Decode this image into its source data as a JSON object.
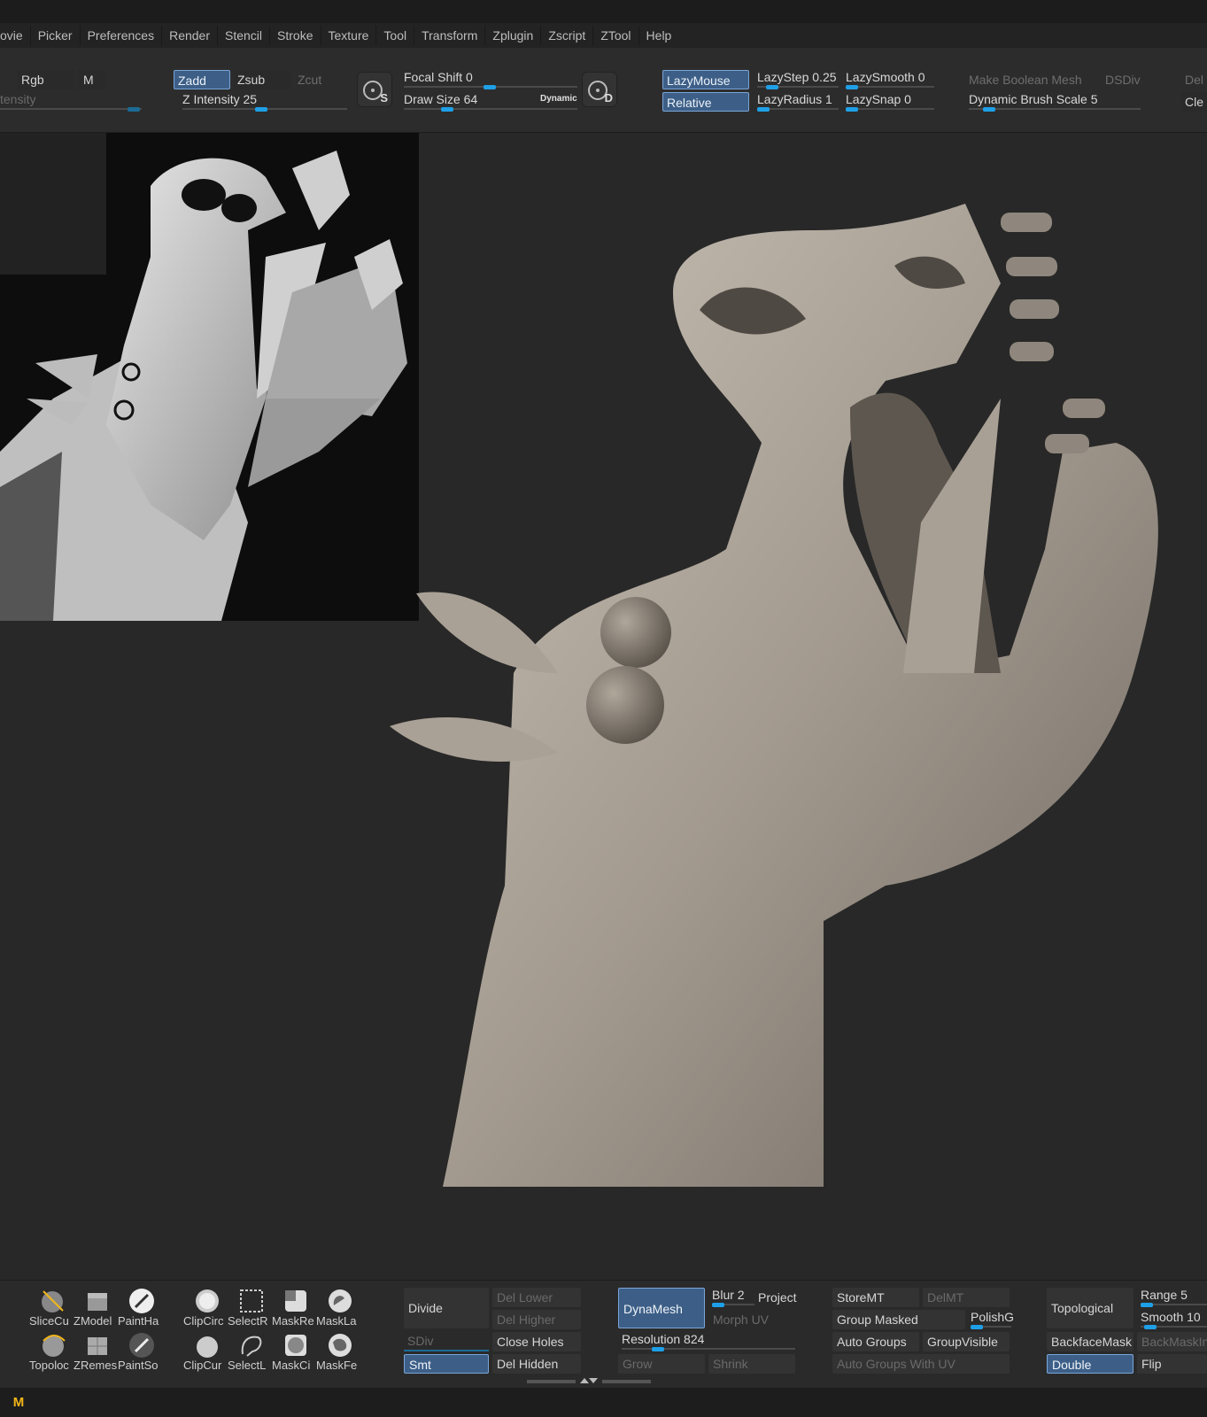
{
  "menu": {
    "items": [
      "ovie",
      "Picker",
      "Preferences",
      "Render",
      "Stencil",
      "Stroke",
      "Texture",
      "Tool",
      "Transform",
      "Zplugin",
      "Zscript",
      "ZTool",
      "Help"
    ]
  },
  "top_shelf": {
    "rgb": "Rgb",
    "m": "M",
    "intensity_partial": "tensity",
    "zadd": "Zadd",
    "zsub": "Zsub",
    "zcut": "Zcut",
    "z_intensity": "Z Intensity 25",
    "focal_shift": "Focal Shift 0",
    "draw_size": "Draw Size 64",
    "dynamic": "Dynamic",
    "s_icon_label": "S",
    "d_icon_label": "D",
    "lazymouse": "LazyMouse",
    "relative": "Relative",
    "lazystep": "LazyStep 0.25",
    "lazyradius": "LazyRadius 1",
    "lazysmooth": "LazySmooth 0",
    "lazysnap": "LazySnap 0",
    "make_boolean_mesh": "Make Boolean Mesh",
    "dsdiv": "DSDiv",
    "dynamic_brush_scale": "Dynamic Brush Scale 5",
    "del_partial": "Del",
    "cle_partial": "Cle",
    "slider_levels": {
      "z_intensity": 0.25,
      "focal_shift": 0.5,
      "draw_size": 0.25,
      "lazystep": 0.25,
      "lazyradius": 0.05,
      "lazysmooth": 0.0,
      "lazysnap": 0.0,
      "dynamic_brush_scale": 0.1
    }
  },
  "bottom_shelf": {
    "tools_row1": [
      "SliceCu",
      "ZModel",
      "PaintHa",
      "ClipCirc",
      "SelectR",
      "MaskRe",
      "MaskLa"
    ],
    "tools_row2": [
      "Topoloc",
      "ZRemes",
      "PaintSo",
      "ClipCur",
      "SelectL",
      "MaskCi",
      "MaskFe"
    ],
    "divide": "Divide",
    "del_lower": "Del Lower",
    "del_higher": "Del Higher",
    "sdiv": "SDiv",
    "close_holes": "Close Holes",
    "smt": "Smt",
    "del_hidden": "Del Hidden",
    "dynamesh": "DynaMesh",
    "blur": "Blur 2",
    "project": "Project",
    "morph_uv": "Morph UV",
    "resolution": "Resolution 824",
    "grow": "Grow",
    "shrink": "Shrink",
    "storemt": "StoreMT",
    "delmt": "DelMT",
    "group_masked": "Group Masked",
    "polishg": "PolishG",
    "auto_groups": "Auto Groups",
    "groupvisible": "GroupVisible",
    "auto_groups_uv": "Auto Groups With UV",
    "topological": "Topological",
    "range": "Range 5",
    "smooth": "Smooth 10",
    "backfacemask": "BackfaceMask",
    "backmask_partial": "BackMaskIn",
    "double": "Double",
    "flip": "Flip",
    "slider_levels": {
      "resolution": 0.1,
      "polishg": 0.1,
      "range": 0.05,
      "smooth": 0.1
    }
  },
  "status": {
    "logo": "M"
  }
}
